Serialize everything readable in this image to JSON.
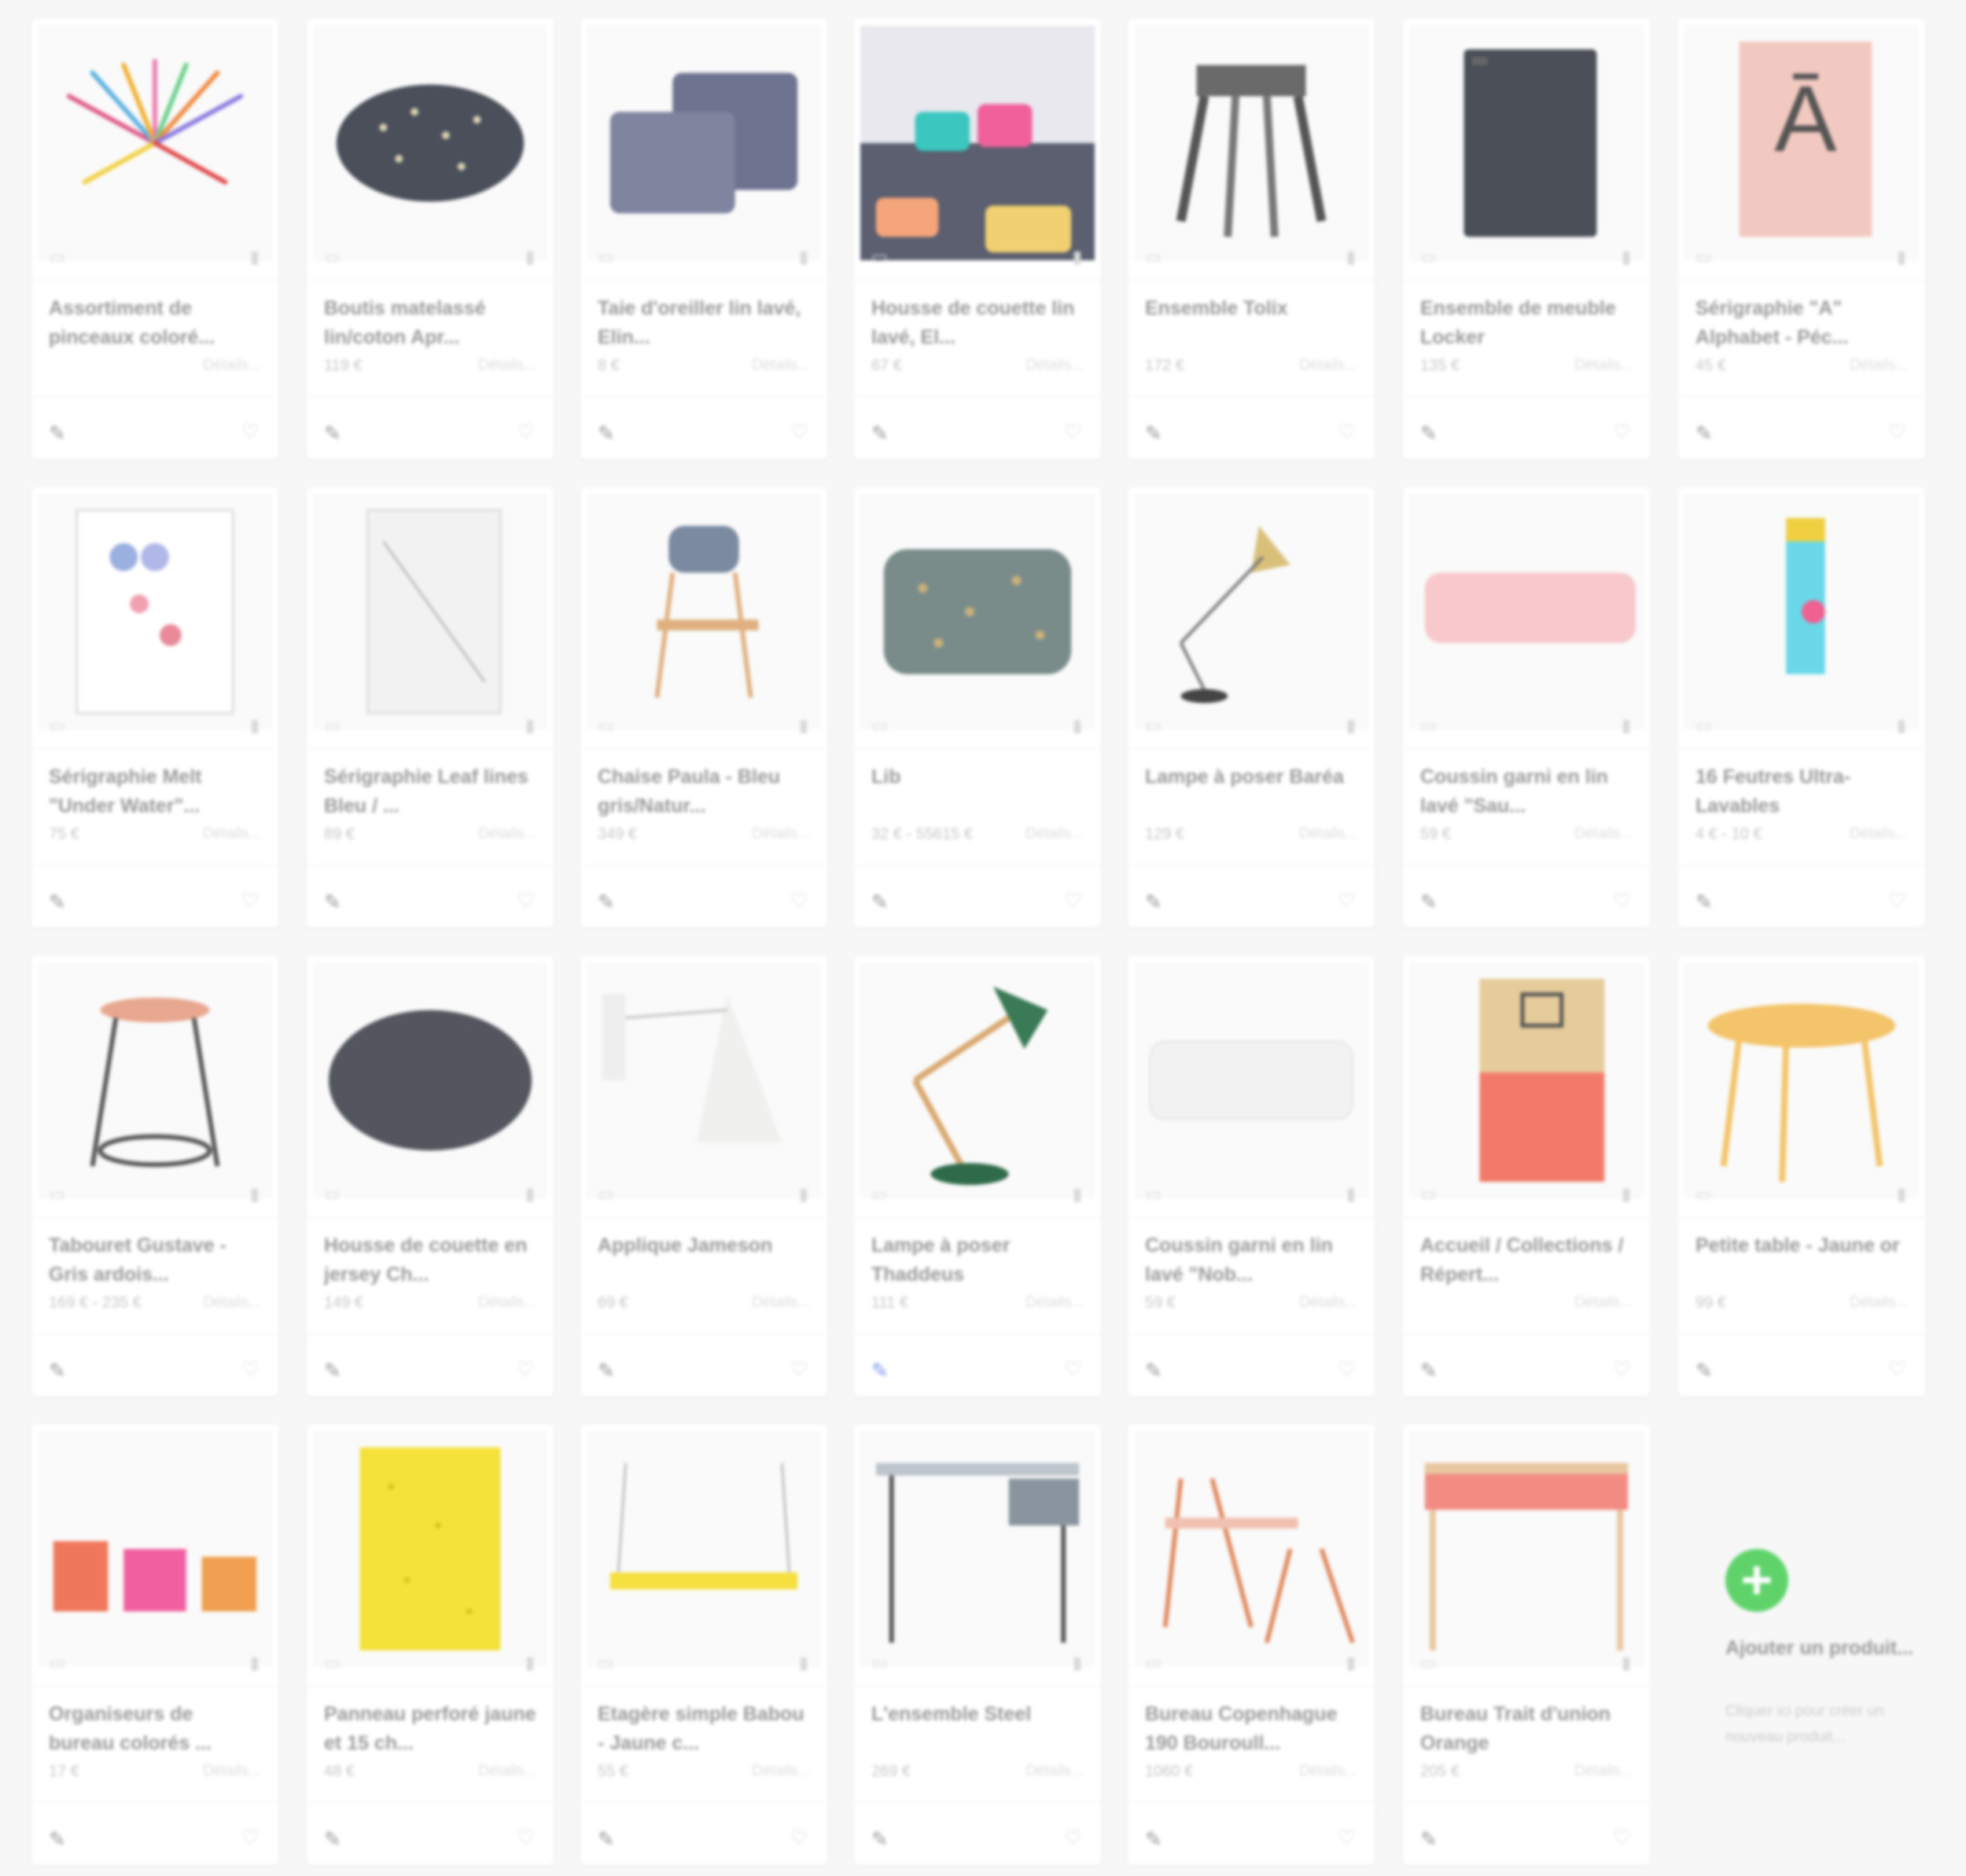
{
  "labels": {
    "details": "Détails..."
  },
  "products": [
    {
      "title": "Assortiment de pinceaux coloré...",
      "price": "",
      "img": "brushes"
    },
    {
      "title": "Boutis matelassé lin/coton Apr...",
      "price": "119 €",
      "img": "quilt"
    },
    {
      "title": "Taie d'oreiller lin lavé, Elin...",
      "price": "8 €",
      "img": "pillows"
    },
    {
      "title": "Housse de couette lin lavé, El...",
      "price": "67 €",
      "img": "bed"
    },
    {
      "title": "Ensemble Tolix",
      "price": "172 €",
      "img": "stool-metal"
    },
    {
      "title": "Ensemble de meuble Locker",
      "price": "135 €",
      "img": "locker"
    },
    {
      "title": "Sérigraphie \"A\" Alphabet - Péc...",
      "price": "45 €",
      "img": "poster-a"
    },
    {
      "title": "Sérigraphie Melt \"Under Water\"...",
      "price": "75 €",
      "img": "poster-melt"
    },
    {
      "title": "Sérigraphie Leaf lines Bleu / ...",
      "price": "89 €",
      "img": "poster-leaf"
    },
    {
      "title": "Chaise Paula - Bleu gris/Natur...",
      "price": "349 €",
      "img": "chair"
    },
    {
      "title": "Lib",
      "price": "32 € - 55615 €",
      "img": "cushion-pattern"
    },
    {
      "title": "Lampe à poser Baréa",
      "price": "129 €",
      "img": "lamp-brass"
    },
    {
      "title": "Coussin garni en lin lavé \"Sau...",
      "price": "59 €",
      "img": "cushion-pink"
    },
    {
      "title": "16 Feutres Ultra-Lavables",
      "price": "4 € - 10 €",
      "img": "markers"
    },
    {
      "title": "Tabouret Gustave - Gris ardois...",
      "price": "169 € - 235 €",
      "img": "stool-wood"
    },
    {
      "title": "Housse de couette en jersey Ch...",
      "price": "149 €",
      "img": "duvet-grey"
    },
    {
      "title": "Applique Jameson",
      "price": "69 €",
      "img": "wall-lamp"
    },
    {
      "title": "Lampe à poser Thaddeus",
      "price": "111 €",
      "img": "lamp-green"
    },
    {
      "title": "Coussin garni en lin lavé \"Nob...",
      "price": "59 €",
      "img": "cushion-white"
    },
    {
      "title": "Accueil / Collections / Répert...",
      "price": "",
      "img": "cabinet"
    },
    {
      "title": "Petite table - Jaune or",
      "price": "99 €",
      "img": "table-yellow"
    },
    {
      "title": "Organiseurs de bureau colorés ...",
      "price": "17 €",
      "img": "organizers"
    },
    {
      "title": "Panneau perforé jaune et 15 ch...",
      "price": "48 €",
      "img": "pegboard"
    },
    {
      "title": "Etagère simple Babou - Jaune c...",
      "price": "55 €",
      "img": "shelf"
    },
    {
      "title": "L'ensemble Steel",
      "price": "269 €",
      "img": "desk-steel"
    },
    {
      "title": "Bureau Copenhague 190 Bouroull...",
      "price": "1060 €",
      "img": "desk-copenhague"
    },
    {
      "title": "Bureau Trait d'union Orange",
      "price": "205 €",
      "img": "desk-pink"
    }
  ],
  "add_card": {
    "title": "Ajouter un produit...",
    "subtitle": "Cliquer ici pour créer un nouveau produit..."
  }
}
